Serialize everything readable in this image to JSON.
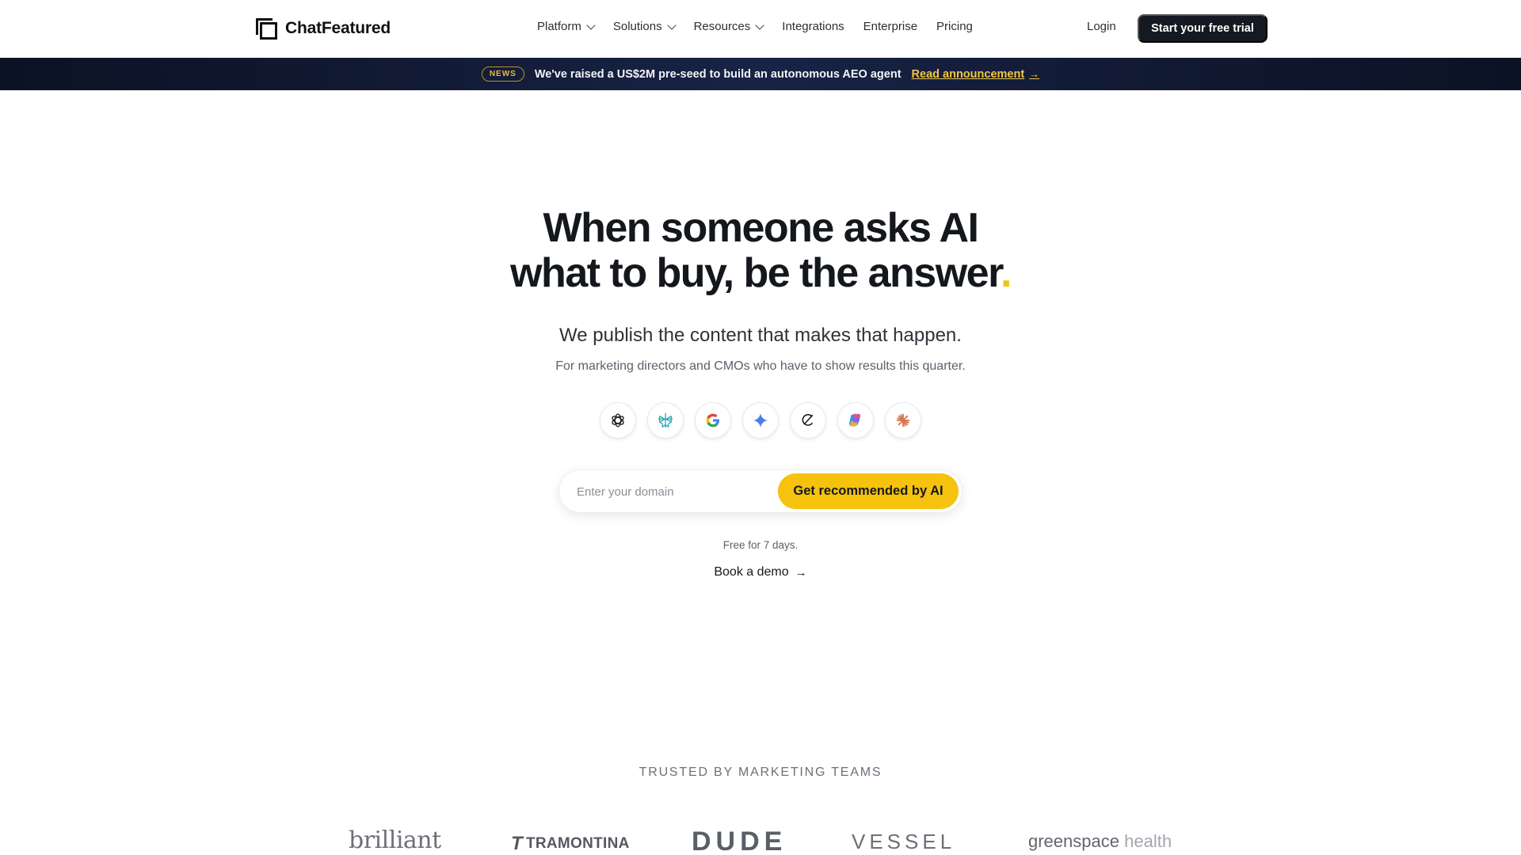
{
  "nav": {
    "logo_text": "ChatFeatured",
    "items": [
      {
        "label": "Platform",
        "has_dropdown": true
      },
      {
        "label": "Solutions",
        "has_dropdown": true
      },
      {
        "label": "Resources",
        "has_dropdown": true
      },
      {
        "label": "Integrations",
        "has_dropdown": false
      },
      {
        "label": "Enterprise",
        "has_dropdown": false
      },
      {
        "label": "Pricing",
        "has_dropdown": false
      }
    ],
    "login_label": "Login",
    "cta_label": "Start your free trial"
  },
  "news": {
    "badge": "NEWS",
    "text": "We've raised a US$2M pre-seed to build an autonomous AEO agent",
    "link_label": "Read announcement",
    "link_arrow": "→"
  },
  "hero": {
    "title_line1": "When someone asks AI",
    "title_line2": "what to buy, be the answer",
    "title_dot": ".",
    "subtitle": "We publish the content that makes that happen.",
    "subtext": "For marketing directors and CMOs who have to show results this quarter.",
    "ai_icons": [
      "chatgpt-icon",
      "perplexity-icon",
      "google-icon",
      "gemini-icon",
      "grok-icon",
      "copilot-icon",
      "claude-icon"
    ],
    "domain_placeholder": "Enter your domain",
    "domain_value": "",
    "submit_label": "Get recommended by AI",
    "free_note": "Free for 7 days.",
    "demo_label": "Book a demo",
    "demo_arrow": "→"
  },
  "trusted": {
    "heading": "TRUSTED BY MARKETING TEAMS",
    "brands": [
      {
        "name": "brilliant"
      },
      {
        "name": "TRAMONTINA",
        "mark": "T"
      },
      {
        "name": "DUDE"
      },
      {
        "name": "VESSEL"
      },
      {
        "name_main": "greenspace",
        "name_light": "health"
      }
    ]
  },
  "colors": {
    "accent_yellow": "#f6c20e",
    "dark_button": "#141922",
    "news_bg": "#141d3a",
    "news_link": "#f2c744"
  }
}
